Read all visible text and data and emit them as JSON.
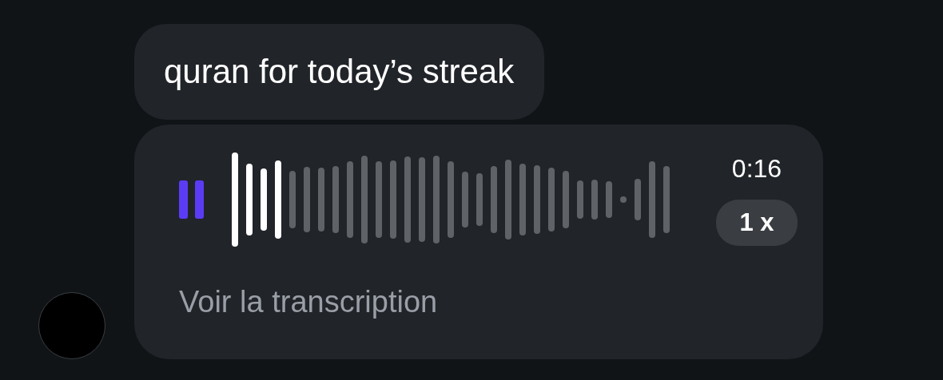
{
  "messages": [
    {
      "kind": "text",
      "text": "quran for today’s streak"
    },
    {
      "kind": "voice",
      "playing": true,
      "level": 0.12,
      "duration": "0:16",
      "speed": "1 x",
      "transcript_link": "Voir la transcription"
    }
  ]
}
